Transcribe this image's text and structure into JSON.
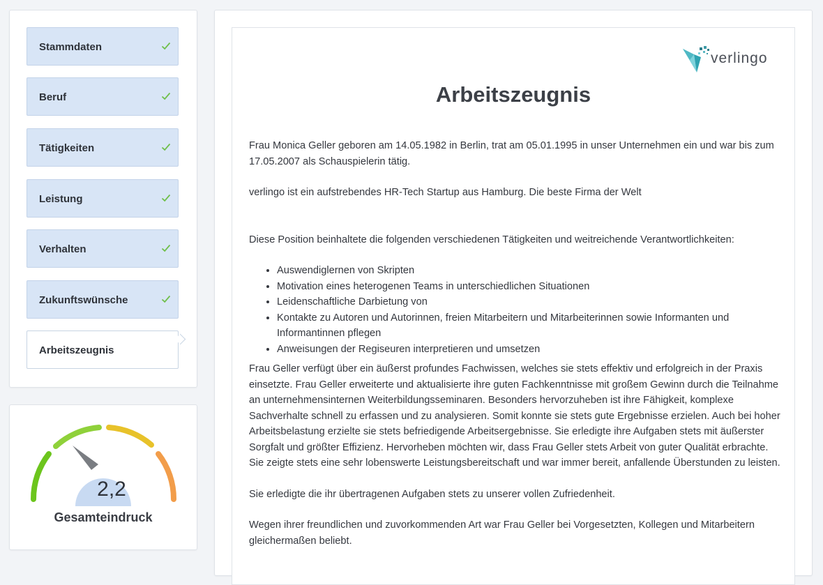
{
  "steps": [
    {
      "label": "Stammdaten",
      "done": true
    },
    {
      "label": "Beruf",
      "done": true
    },
    {
      "label": "Tätigkeiten",
      "done": true
    },
    {
      "label": "Leistung",
      "done": true
    },
    {
      "label": "Verhalten",
      "done": true
    },
    {
      "label": "Zukunftswünsche",
      "done": true
    },
    {
      "label": "Arbeitszeugnis",
      "done": false
    }
  ],
  "gauge": {
    "value": "2,2",
    "caption": "Gesamteindruck",
    "segment_colors": [
      "#6cc51d",
      "#8fd13a",
      "#e8c22a",
      "#f29d4a"
    ]
  },
  "colors": {
    "step_bg": "#d8e5f6",
    "check": "#6fbf4a"
  },
  "document": {
    "logo_text": "verlingo",
    "title": "Arbeitszeugnis",
    "intro": "Frau Monica Geller geboren am 14.05.1982 in Berlin, trat am 05.01.1995 in unser Unternehmen ein und war bis zum 17.05.2007 als Schauspielerin tätig.",
    "company": "verlingo ist ein aufstrebendes HR-Tech Startup aus Hamburg. Die beste Firma der Welt",
    "duties_intro": "Diese Position beinhaltete die folgenden verschiedenen Tätigkeiten und weitreichende Verantwortlichkeiten:",
    "duties": [
      "Auswendiglernen von Skripten",
      "Motivation eines heterogenen Teams in unterschiedlichen Situationen",
      "Leidenschaftliche Darbietung von",
      "Kontakte zu Autoren und Autorinnen, freien Mitarbeitern und Mitarbeiterinnen sowie Informanten und Informantinnen pflegen",
      "Anweisungen der Regiseuren interpretieren und umsetzen"
    ],
    "performance": "Frau Geller verfügt über ein äußerst profundes Fachwissen, welches sie stets effektiv und erfolgreich in der Praxis einsetzte. Frau Geller erweiterte und aktualisierte ihre guten Fachkenntnisse mit großem Gewinn durch die Teilnahme an unternehmensinternen Weiterbildungsseminaren. Besonders hervorzuheben ist ihre Fähigkeit, komplexe Sachverhalte schnell zu erfassen und zu analysieren. Somit konnte sie stets gute Ergebnisse erzielen. Auch bei hoher Arbeitsbelastung erzielte sie stets befriedigende Arbeitsergebnisse. Sie erledigte ihre Aufgaben stets mit äußerster Sorgfalt und größter Effizienz. Hervorheben möchten wir, dass Frau Geller stets Arbeit von guter Qualität erbrachte. Sie zeigte stets eine sehr lobenswerte Leistungsbereitschaft und war immer bereit, anfallende Überstunden zu leisten.",
    "satisfaction": "Sie erledigte die ihr übertragenen Aufgaben stets zu unserer vollen Zufriedenheit.",
    "behavior": "Wegen ihrer freundlichen und zuvorkommenden Art war Frau Geller bei Vorgesetzten, Kollegen und Mitarbeitern gleichermaßen beliebt."
  }
}
